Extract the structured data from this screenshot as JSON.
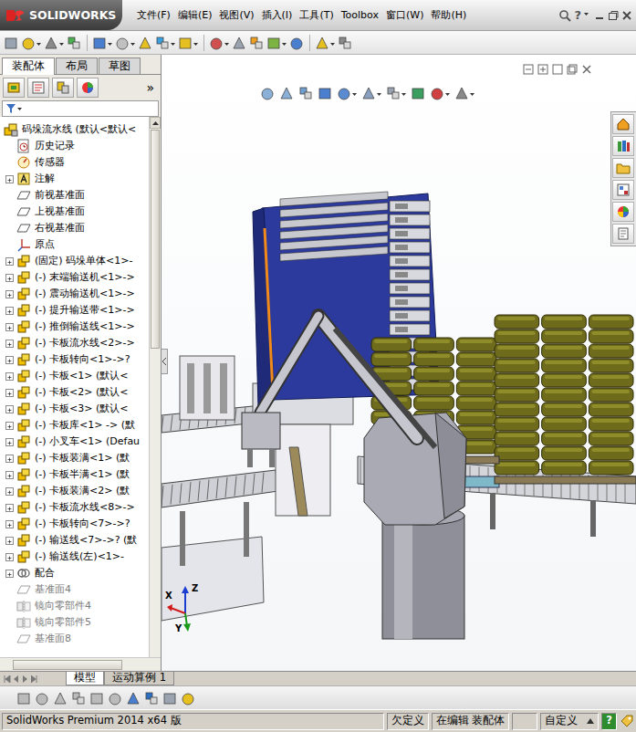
{
  "app": {
    "logo_text": "SOLIDWORKS"
  },
  "menu": [
    "文件(F)",
    "编辑(E)",
    "视图(V)",
    "插入(I)",
    "工具(T)",
    "Toolbox",
    "窗口(W)",
    "帮助(H)"
  ],
  "title_bar": {
    "help": "?"
  },
  "feature_manager": {
    "tabs": [
      {
        "label": "装配体",
        "selected": true
      },
      {
        "label": "布局",
        "selected": false
      },
      {
        "label": "草图",
        "selected": false
      }
    ],
    "more": "»",
    "tree": [
      {
        "label": "码垛流水线 (默认<默认<",
        "kind": "root",
        "greyed": false
      },
      {
        "label": "历史记录",
        "kind": "history",
        "greyed": false
      },
      {
        "label": "传感器",
        "kind": "sensor",
        "greyed": false
      },
      {
        "label": "注解",
        "kind": "annotation",
        "greyed": false,
        "expanded": false
      },
      {
        "label": "前视基准面",
        "kind": "plane",
        "greyed": false
      },
      {
        "label": "上视基准面",
        "kind": "plane",
        "greyed": false
      },
      {
        "label": "右视基准面",
        "kind": "plane",
        "greyed": false
      },
      {
        "label": "原点",
        "kind": "origin",
        "greyed": false
      },
      {
        "label": "(固定) 码垛单体<1>-",
        "kind": "component",
        "greyed": false,
        "expanded": false
      },
      {
        "label": "(-) 末端输送机<1>->",
        "kind": "component",
        "greyed": false,
        "expanded": false
      },
      {
        "label": "(-) 震动输送机<1>->",
        "kind": "component",
        "greyed": false,
        "expanded": false
      },
      {
        "label": "(-) 提升输送带<1>->",
        "kind": "component",
        "greyed": false,
        "expanded": false
      },
      {
        "label": "(-) 推倒输送线<1>->",
        "kind": "component",
        "greyed": false,
        "expanded": false
      },
      {
        "label": "(-) 卡板流水线<2>->",
        "kind": "component",
        "greyed": false,
        "expanded": false
      },
      {
        "label": "(-) 卡板转向<1>->?",
        "kind": "component",
        "greyed": false,
        "expanded": false
      },
      {
        "label": "(-) 卡板<1> (默认<",
        "kind": "component",
        "greyed": false,
        "expanded": false
      },
      {
        "label": "(-) 卡板<2> (默认<",
        "kind": "component",
        "greyed": false,
        "expanded": false
      },
      {
        "label": "(-) 卡板<3> (默认<",
        "kind": "component",
        "greyed": false,
        "expanded": false
      },
      {
        "label": "(-) 卡板库<1> -> (默",
        "kind": "component",
        "greyed": false,
        "expanded": false
      },
      {
        "label": "(-) 小叉车<1> (Defau",
        "kind": "component",
        "greyed": false,
        "expanded": false
      },
      {
        "label": "(-) 卡板装满<1> (默",
        "kind": "component",
        "greyed": false,
        "expanded": false
      },
      {
        "label": "(-) 卡板半满<1> (默",
        "kind": "component",
        "greyed": false,
        "expanded": false
      },
      {
        "label": "(-) 卡板装满<2> (默",
        "kind": "component",
        "greyed": false,
        "expanded": false
      },
      {
        "label": "(-) 卡板流水线<8>->",
        "kind": "component",
        "greyed": false,
        "expanded": false
      },
      {
        "label": "(-) 卡板转向<7>->?",
        "kind": "component",
        "greyed": false,
        "expanded": false
      },
      {
        "label": "(-) 输送线<7>->? (默",
        "kind": "component",
        "greyed": false,
        "expanded": false
      },
      {
        "label": "(-) 输送线(左)<1>-",
        "kind": "component",
        "greyed": false,
        "expanded": false
      },
      {
        "label": "配合",
        "kind": "mates",
        "greyed": false,
        "expanded": false
      },
      {
        "label": "基准面4",
        "kind": "plane",
        "greyed": true
      },
      {
        "label": "镜向零部件4",
        "kind": "mirror",
        "greyed": true
      },
      {
        "label": "镜向零部件5",
        "kind": "mirror",
        "greyed": true
      },
      {
        "label": "基准面8",
        "kind": "plane",
        "greyed": true
      }
    ]
  },
  "viewport": {
    "triad": {
      "z": "Z",
      "x": "X",
      "y": "Y"
    }
  },
  "bottom_tabs": [
    {
      "label": "模型",
      "selected": true
    },
    {
      "label": "运动算例 1",
      "selected": false
    }
  ],
  "status_bar": {
    "product": "SolidWorks Premium 2014 x64 版",
    "definition": "欠定义",
    "mode": "在编辑 装配体",
    "units": "自定义",
    "help": "?"
  }
}
